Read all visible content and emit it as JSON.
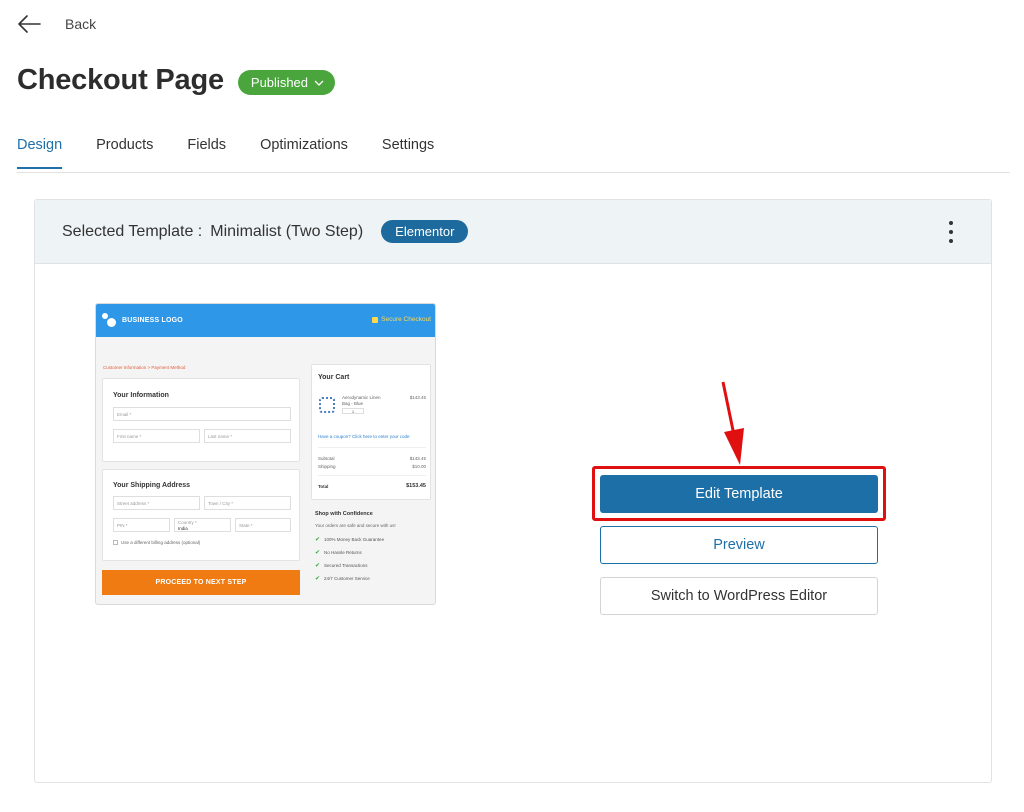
{
  "header": {
    "back_label": "Back",
    "page_title": "Checkout Page",
    "status": "Published"
  },
  "tabs": [
    {
      "label": "Design",
      "active": true
    },
    {
      "label": "Products",
      "active": false
    },
    {
      "label": "Fields",
      "active": false
    },
    {
      "label": "Optimizations",
      "active": false
    },
    {
      "label": "Settings",
      "active": false
    }
  ],
  "template_card": {
    "label": "Selected Template :",
    "name": "Minimalist  (Two Step)",
    "builder": "Elementor"
  },
  "preview": {
    "logo_text": "BUSINESS LOGO",
    "secure_text": "Secure Checkout",
    "breadcrumb": "Customer Information  >  Payment Method",
    "info_title": "Your Information",
    "email_placeholder": "Email *",
    "first_name_placeholder": "First name *",
    "last_name_placeholder": "Last name *",
    "shipping_title": "Your Shipping Address",
    "street_placeholder": "Street address *",
    "town_placeholder": "Town / City *",
    "pin_placeholder": "PIN *",
    "country_label": "Country *",
    "country_value": "India",
    "state_placeholder": "State *",
    "different_address": "Use a different billing address (optional)",
    "proceed_button": "PROCEED TO NEXT STEP",
    "cart_title": "Your Cart",
    "product_name": "Aerodynamic Linen Bag - Blue",
    "product_price": "$143.45",
    "product_qty": "1",
    "coupon_text": "Have a coupon? Click here to enter your code",
    "subtotal_label": "Subtotal",
    "subtotal_value": "$143.45",
    "shipping_label": "Shipping",
    "shipping_value": "$10.00",
    "total_label": "Total",
    "total_value": "$153.45",
    "confidence_title": "Shop with Confidence",
    "confidence_text": "Your orders are safe and secure with us!",
    "guarantees": [
      "100% Money Back Guarantee",
      "No Hassle Returns",
      "Secured Transactions",
      "24/7 Customer Service"
    ]
  },
  "actions": {
    "edit_label": "Edit Template",
    "preview_label": "Preview",
    "switch_label": "Switch to WordPress Editor"
  },
  "colors": {
    "accent": "#1d6fa8",
    "published_badge": "#4aa53d",
    "highlight": "#e01010"
  },
  "icons": {
    "back": "arrow-left-icon",
    "status_dropdown": "chevron-down-icon",
    "more": "kebab-menu-icon",
    "pointer": "red-arrow-down-icon"
  }
}
